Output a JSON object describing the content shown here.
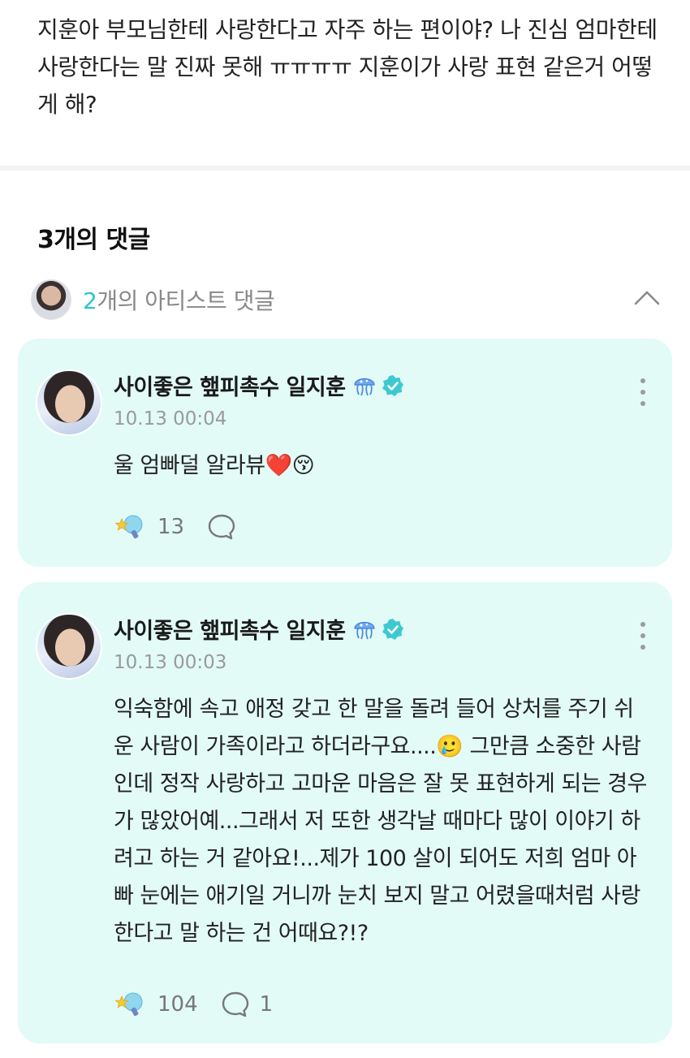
{
  "post": {
    "text": "지훈아 부모님한테 사랑한다고 자주 하는 편이야? 나 진심 엄마한테 사랑한다는 말 진짜 못해 ㅠㅠㅠㅠ 지훈이가 사랑 표현 같은거 어떻게 해?"
  },
  "comments_header": {
    "title": "3개의 댓글"
  },
  "artist_toggle": {
    "count": "2",
    "label": "개의 아티스트 댓글"
  },
  "comments": [
    {
      "author": "사이좋은 햎피촉수 일지훈",
      "timestamp": "10.13 00:04",
      "text": "울 엄빠덜 알라뷰❤️😚",
      "likes": "13",
      "replies": ""
    },
    {
      "author": "사이좋은 햎피촉수 일지훈",
      "timestamp": "10.13 00:03",
      "text": "익숙함에 속고 애정 갖고 한 말을 돌려 들어 상처를 주기 쉬운 사람이 가족이라고 하더라구요....🥲 그만큼 소중한 사람인데 정작 사랑하고 고마운 마음은 잘 못 표현하게 되는 경우가 많았어예...그래서 저 또한 생각날 때마다 많이 이야기 하려고 하는 거 같아요!...제가 100 살이 되어도 저희 엄마 아빠 눈에는 애기일 거니까 눈치 보지 말고 어렸을때처럼 사랑한다고 말 하는 건 어때요?!?",
      "likes": "104",
      "replies": "1"
    }
  ],
  "icons": {
    "jelly": "jellyfish-icon",
    "verified": "verified-badge-icon",
    "more": "more-vertical-icon",
    "like": "star-wand-like-icon",
    "reply": "speech-bubble-icon",
    "chevron": "chevron-up-icon"
  },
  "colors": {
    "card_background": "#e2fbf6",
    "accent": "#2cc6c8",
    "verified": "#2cc6c8"
  }
}
